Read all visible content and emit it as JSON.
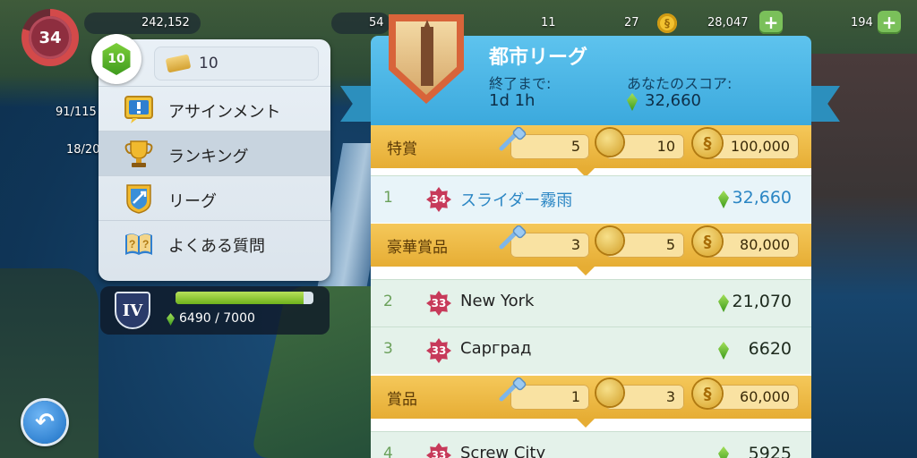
{
  "hud": {
    "player_level": "34",
    "population": "242,152",
    "stat_a": "91/115",
    "stat_b": "18/20",
    "cash_partial": "54",
    "golden_keys": "11",
    "keys": "27",
    "simoleons": "28,047",
    "simcash": "194"
  },
  "menu": {
    "league_tier_level": "10",
    "tickets": "10",
    "items": [
      {
        "label": "アサインメント",
        "icon": "assignment-icon"
      },
      {
        "label": "ランキング",
        "icon": "trophy-icon",
        "selected": true
      },
      {
        "label": "リーグ",
        "icon": "league-shield-icon"
      },
      {
        "label": "よくある質問",
        "icon": "faq-book-icon"
      }
    ]
  },
  "tier_progress": {
    "tier": "IV",
    "current": "6490",
    "separator": "/",
    "max": "7000",
    "fraction": 0.927
  },
  "league": {
    "title": "都市リーグ",
    "ends_label": "終了まで:",
    "ends_value": "1d 1h",
    "score_label": "あなたのスコア:",
    "score_value": "32,660"
  },
  "list": {
    "prizes": [
      {
        "label": "特賞",
        "keys": "5",
        "stopwatches": "10",
        "coins": "100,000"
      },
      {
        "label": "豪華賞品",
        "keys": "3",
        "stopwatches": "5",
        "coins": "80,000"
      },
      {
        "label": "賞品",
        "keys": "1",
        "stopwatches": "3",
        "coins": "60,000"
      }
    ],
    "players": [
      {
        "rank": "1",
        "level": "34",
        "name": "スライダー霧雨",
        "score": "32,660"
      },
      {
        "rank": "2",
        "level": "33",
        "name": "New York",
        "score": "21,070"
      },
      {
        "rank": "3",
        "level": "33",
        "name": "Сарград",
        "score": "6620"
      },
      {
        "rank": "4",
        "level": "33",
        "name": "Screw City",
        "score": "5925"
      }
    ]
  },
  "colors": {
    "header_blue": "#3ba9dd",
    "prize_gold": "#e6ad34",
    "row_green": "#e4f2ea",
    "self_name_blue": "#2b86c4",
    "gem_green": "#4caf1e"
  }
}
